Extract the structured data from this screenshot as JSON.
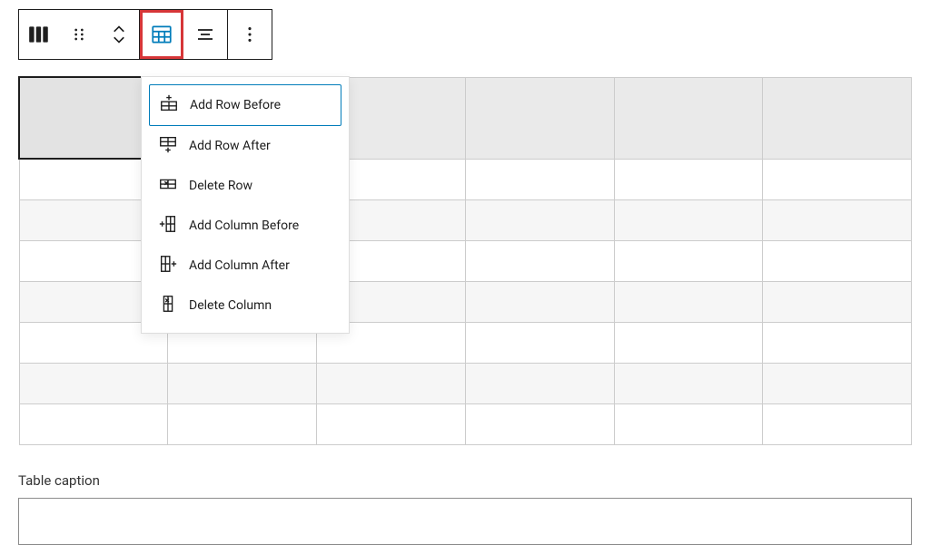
{
  "toolbar": {
    "block_type": "table",
    "drag_handle": "drag",
    "move": "move",
    "edit_table": "edit-table",
    "align": "align",
    "more": "more"
  },
  "dropdown": {
    "items": [
      {
        "icon": "add-row-before",
        "label": "Add Row Before",
        "selected": true
      },
      {
        "icon": "add-row-after",
        "label": "Add Row After",
        "selected": false
      },
      {
        "icon": "delete-row",
        "label": "Delete Row",
        "selected": false
      },
      {
        "icon": "add-col-before",
        "label": "Add Column Before",
        "selected": false
      },
      {
        "icon": "add-col-after",
        "label": "Add Column After",
        "selected": false
      },
      {
        "icon": "delete-col",
        "label": "Delete Column",
        "selected": false
      }
    ]
  },
  "table": {
    "cols": 6,
    "body_rows": 7,
    "selected_cell": [
      0,
      0
    ]
  },
  "caption": {
    "label": "Table caption",
    "value": ""
  }
}
